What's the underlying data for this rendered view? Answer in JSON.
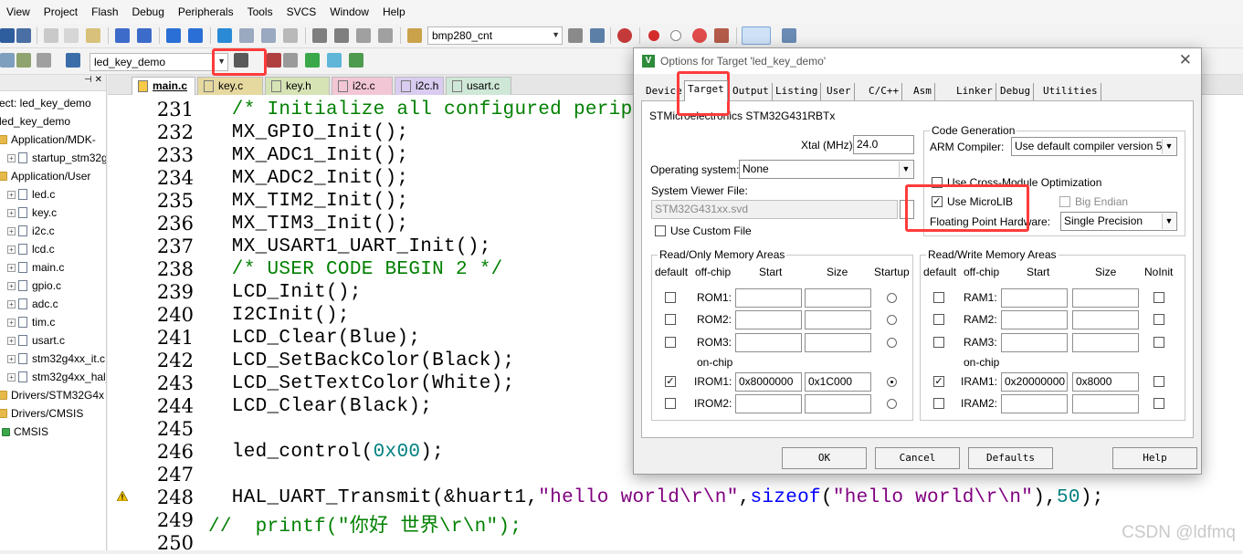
{
  "menu": [
    "View",
    "Project",
    "Flash",
    "Debug",
    "Peripherals",
    "Tools",
    "SVCS",
    "Window",
    "Help"
  ],
  "toolbar": {
    "target_combo": "bmp280_cnt",
    "project_combo": "led_key_demo"
  },
  "project_tree": {
    "items": [
      {
        "label": "ect: led_key_demo",
        "kind": "root"
      },
      {
        "label": "led_key_demo",
        "kind": "target"
      },
      {
        "label": "Application/MDK-",
        "kind": "folder"
      },
      {
        "label": "startup_stm32g",
        "kind": "file"
      },
      {
        "label": "Application/User",
        "kind": "folder"
      },
      {
        "label": "led.c",
        "kind": "file"
      },
      {
        "label": "key.c",
        "kind": "file"
      },
      {
        "label": "i2c.c",
        "kind": "file"
      },
      {
        "label": "lcd.c",
        "kind": "file"
      },
      {
        "label": "main.c",
        "kind": "file"
      },
      {
        "label": "gpio.c",
        "kind": "file"
      },
      {
        "label": "adc.c",
        "kind": "file"
      },
      {
        "label": "tim.c",
        "kind": "file"
      },
      {
        "label": "usart.c",
        "kind": "file"
      },
      {
        "label": "stm32g4xx_it.c",
        "kind": "file"
      },
      {
        "label": "stm32g4xx_hal_",
        "kind": "file"
      },
      {
        "label": "Drivers/STM32G4x",
        "kind": "folder"
      },
      {
        "label": "Drivers/CMSIS",
        "kind": "folder"
      },
      {
        "label": "CMSIS",
        "kind": "component"
      }
    ]
  },
  "editor_tabs": [
    {
      "label": "main.c",
      "color": "#f7c948",
      "active": true
    },
    {
      "label": "key.c",
      "color": "#e6d9a0"
    },
    {
      "label": "key.h",
      "color": "#d6e3b5"
    },
    {
      "label": "i2c.c",
      "color": "#f2c6d4"
    },
    {
      "label": "i2c.h",
      "color": "#d9ccf0"
    },
    {
      "label": "usart.c",
      "color": "#cfe7d6"
    }
  ],
  "code_lines": [
    {
      "n": "231",
      "parts": [
        {
          "t": "  /* Initialize all configured perip",
          "c": "cmt"
        }
      ]
    },
    {
      "n": "232",
      "parts": [
        {
          "t": "  MX_GPIO_Init();",
          "c": ""
        }
      ]
    },
    {
      "n": "233",
      "parts": [
        {
          "t": "  MX_ADC1_Init();",
          "c": ""
        }
      ]
    },
    {
      "n": "234",
      "parts": [
        {
          "t": "  MX_ADC2_Init();",
          "c": ""
        }
      ]
    },
    {
      "n": "235",
      "parts": [
        {
          "t": "  MX_TIM2_Init();",
          "c": ""
        }
      ]
    },
    {
      "n": "236",
      "parts": [
        {
          "t": "  MX_TIM3_Init();",
          "c": ""
        }
      ]
    },
    {
      "n": "237",
      "parts": [
        {
          "t": "  MX_USART1_UART_Init();",
          "c": ""
        }
      ]
    },
    {
      "n": "238",
      "parts": [
        {
          "t": "  /* USER CODE BEGIN 2 */",
          "c": "cmt"
        }
      ]
    },
    {
      "n": "239",
      "parts": [
        {
          "t": "  LCD_Init();",
          "c": ""
        }
      ]
    },
    {
      "n": "240",
      "parts": [
        {
          "t": "  I2CInit();",
          "c": ""
        }
      ]
    },
    {
      "n": "241",
      "parts": [
        {
          "t": "  LCD_Clear(Blue);",
          "c": ""
        }
      ]
    },
    {
      "n": "242",
      "parts": [
        {
          "t": "  LCD_SetBackColor(Black);",
          "c": ""
        }
      ]
    },
    {
      "n": "243",
      "parts": [
        {
          "t": "  LCD_SetTextColor(White);",
          "c": ""
        }
      ]
    },
    {
      "n": "244",
      "parts": [
        {
          "t": "  LCD_Clear(Black);",
          "c": ""
        }
      ]
    },
    {
      "n": "245",
      "parts": []
    },
    {
      "n": "246",
      "parts": [
        {
          "t": "  led_control(",
          "c": ""
        },
        {
          "t": "0x00",
          "c": "num"
        },
        {
          "t": ");",
          "c": ""
        }
      ]
    },
    {
      "n": "247",
      "parts": []
    },
    {
      "n": "248",
      "parts": [
        {
          "t": "  HAL_UART_Transmit(&huart1,",
          "c": ""
        },
        {
          "t": "\"hello world\\r\\n\"",
          "c": "str"
        },
        {
          "t": ",",
          "c": ""
        },
        {
          "t": "sizeof",
          "c": "kw"
        },
        {
          "t": "(",
          "c": ""
        },
        {
          "t": "\"hello world\\r\\n\"",
          "c": "str"
        },
        {
          "t": "),",
          "c": ""
        },
        {
          "t": "50",
          "c": "num"
        },
        {
          "t": ");",
          "c": ""
        }
      ]
    },
    {
      "n": "249",
      "parts": [
        {
          "t": "//  printf(\"你好 世界\\r\\n\");",
          "c": "cmt"
        }
      ]
    },
    {
      "n": "250",
      "parts": []
    }
  ],
  "dialog": {
    "title": "Options for Target 'led_key_demo'",
    "tabs": [
      "Device",
      "Target",
      "Output",
      "Listing",
      "User",
      "C/C++",
      "Asm",
      "Linker",
      "Debug",
      "Utilities"
    ],
    "active_tab": "Target",
    "device_name": "STMicroelectronics STM32G431RBTx",
    "xtal_label": "Xtal (MHz):",
    "xtal_value": "24.0",
    "os_label": "Operating system:",
    "os_value": "None",
    "svd_label": "System Viewer File:",
    "svd_value": "STM32G431xx.svd",
    "use_custom_file": "Use Custom File",
    "code_gen": {
      "title": "Code Generation",
      "compiler_label": "ARM Compiler:",
      "compiler_value": "Use default compiler version 5",
      "cross_module": "Use Cross-Module Optimization",
      "microlib": "Use MicroLIB",
      "big_endian": "Big Endian",
      "fpu_label": "Floating Point Hardware:",
      "fpu_value": "Single Precision"
    },
    "ro": {
      "title": "Read/Only Memory Areas",
      "headers": {
        "def": "default",
        "off": "off-chip",
        "start": "Start",
        "size": "Size",
        "startup": "Startup"
      },
      "onchip": "on-chip",
      "rows": [
        {
          "name": "ROM1:",
          "start": "",
          "size": "",
          "checked": false,
          "startup": false
        },
        {
          "name": "ROM2:",
          "start": "",
          "size": "",
          "checked": false,
          "startup": false
        },
        {
          "name": "ROM3:",
          "start": "",
          "size": "",
          "checked": false,
          "startup": false
        },
        {
          "name": "IROM1:",
          "start": "0x8000000",
          "size": "0x1C000",
          "checked": true,
          "startup": true
        },
        {
          "name": "IROM2:",
          "start": "",
          "size": "",
          "checked": false,
          "startup": false
        }
      ]
    },
    "rw": {
      "title": "Read/Write Memory Areas",
      "headers": {
        "def": "default",
        "off": "off-chip",
        "start": "Start",
        "size": "Size",
        "noinit": "NoInit"
      },
      "onchip": "on-chip",
      "rows": [
        {
          "name": "RAM1:",
          "start": "",
          "size": "",
          "checked": false
        },
        {
          "name": "RAM2:",
          "start": "",
          "size": "",
          "checked": false
        },
        {
          "name": "RAM3:",
          "start": "",
          "size": "",
          "checked": false
        },
        {
          "name": "IRAM1:",
          "start": "0x20000000",
          "size": "0x8000",
          "checked": true
        },
        {
          "name": "IRAM2:",
          "start": "",
          "size": "",
          "checked": false
        }
      ]
    },
    "buttons": {
      "ok": "OK",
      "cancel": "Cancel",
      "defaults": "Defaults",
      "help": "Help"
    }
  },
  "watermark": "CSDN @ldfmq",
  "colors": {
    "highlight": "#ff3b3b",
    "comment": "#008000",
    "string": "#800080"
  }
}
